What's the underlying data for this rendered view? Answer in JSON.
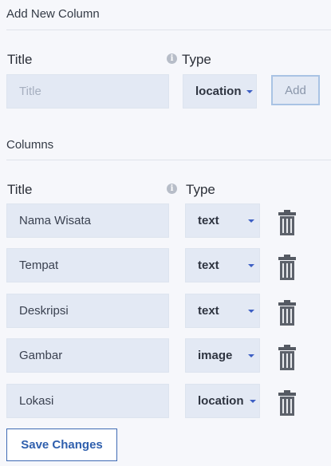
{
  "add_section": {
    "heading": "Add New Column",
    "title_label": "Title",
    "type_label": "Type",
    "title_placeholder": "Title",
    "type_value": "location",
    "add_label": "Add"
  },
  "columns_section": {
    "heading": "Columns",
    "title_label": "Title",
    "type_label": "Type",
    "rows": [
      {
        "title": "Nama Wisata",
        "type": "text"
      },
      {
        "title": "Tempat",
        "type": "text"
      },
      {
        "title": "Deskripsi",
        "type": "text"
      },
      {
        "title": "Gambar",
        "type": "image"
      },
      {
        "title": "Lokasi",
        "type": "location"
      }
    ]
  },
  "save_label": "Save Changes",
  "icons": {
    "info": "info-icon",
    "delete": "trash-icon",
    "dropdown": "caret-down-icon"
  },
  "colors": {
    "field_bg": "#e3e9f4",
    "accent": "#3d5fc4",
    "save_border": "#3f6ab4"
  }
}
